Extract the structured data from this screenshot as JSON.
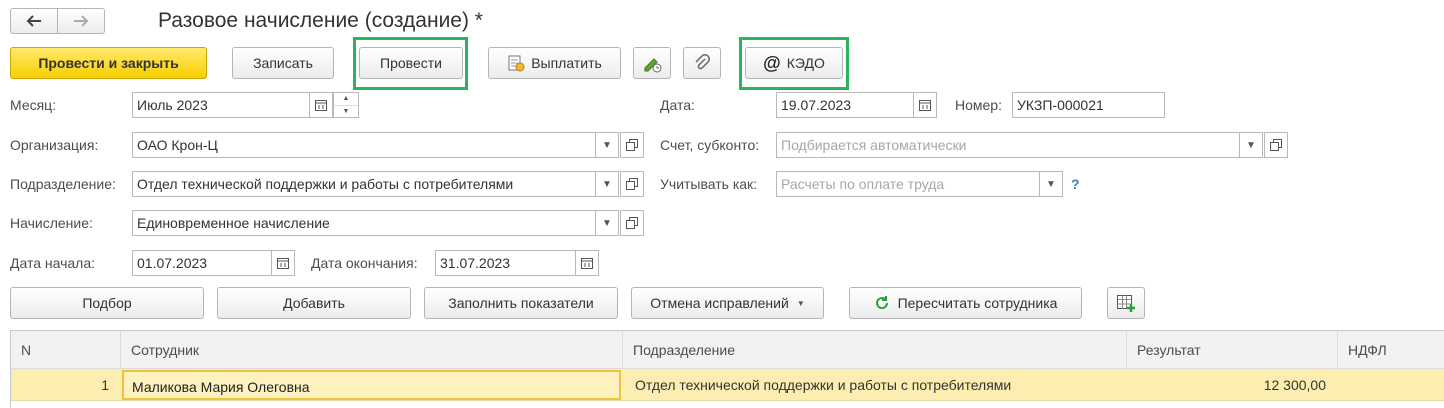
{
  "window": {
    "title": "Разовое начисление (создание) *"
  },
  "nav": {
    "back_icon": "arrow-left-icon",
    "forward_icon": "arrow-right-icon"
  },
  "toolbar": {
    "post_close": "Провести и закрыть",
    "save": "Записать",
    "post": "Провести",
    "pay": "Выплатить",
    "kedo": "КЭДО"
  },
  "form": {
    "month": {
      "label": "Месяц:",
      "value": "Июль 2023"
    },
    "date": {
      "label": "Дата:",
      "value": "19.07.2023"
    },
    "number": {
      "label": "Номер:",
      "value": "УКЗП-000021"
    },
    "organization": {
      "label": "Организация:",
      "value": "ОАО Крон-Ц"
    },
    "account": {
      "label": "Счет, субконто:",
      "placeholder": "Подбирается автоматически"
    },
    "department": {
      "label": "Подразделение:",
      "value": "Отдел технической поддержки и работы с потребителями"
    },
    "account_as": {
      "label": "Учитывать как:",
      "placeholder": "Расчеты по оплате труда",
      "help": "?"
    },
    "accrual": {
      "label": "Начисление:",
      "value": "Единовременное начисление"
    },
    "start_date": {
      "label": "Дата начала:",
      "value": "01.07.2023"
    },
    "end_date": {
      "label": "Дата окончания:",
      "value": "31.07.2023"
    }
  },
  "table_toolbar": {
    "select": "Подбор",
    "add": "Добавить",
    "fill": "Заполнить показатели",
    "cancel_fixes": "Отмена исправлений",
    "recalc": "Пересчитать сотрудника"
  },
  "table": {
    "columns": [
      "N",
      "Сотрудник",
      "Подразделение",
      "Результат",
      "НДФЛ"
    ],
    "rows": [
      {
        "n": "1",
        "employee": "Маликова Мария Олеговна",
        "department": "Отдел технической поддержки и работы с потребителями",
        "result": "12 300,00",
        "ndfl": ""
      }
    ]
  },
  "colors": {
    "primary": "#f6cf00",
    "highlight": "#29b35a",
    "row_selected": "#fbeeb0",
    "help": "#3b7fc4"
  }
}
